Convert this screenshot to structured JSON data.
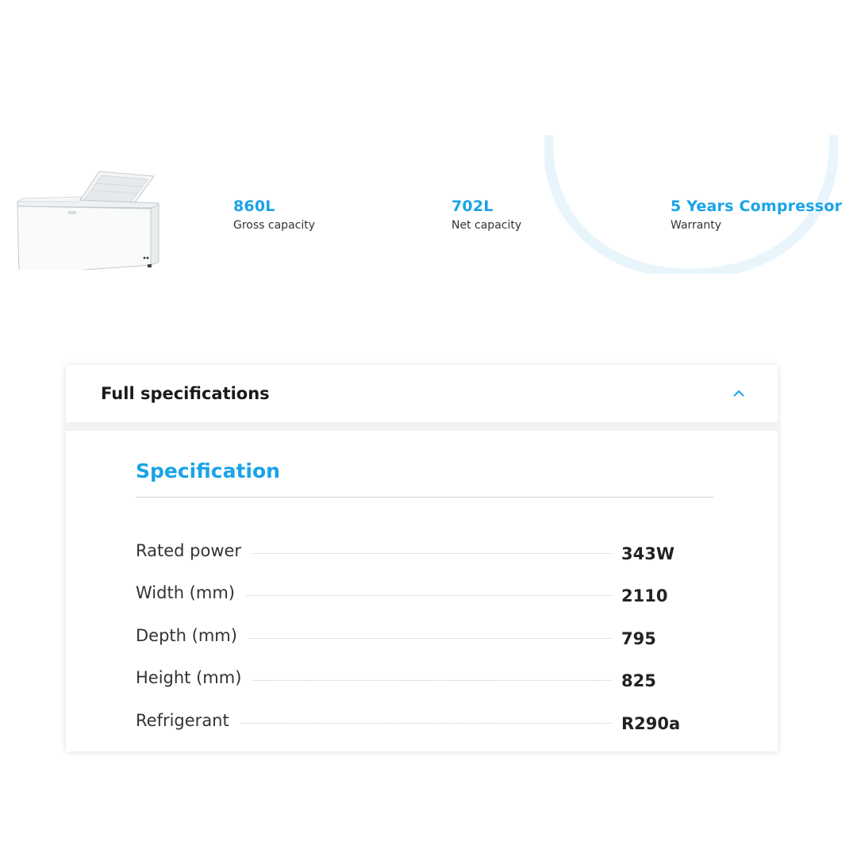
{
  "stats": [
    {
      "value": "860L",
      "label": "Gross capacity"
    },
    {
      "value": "702L",
      "label": "Net capacity"
    },
    {
      "value": "5 Years Compressor",
      "label": "Warranty"
    }
  ],
  "panel": {
    "title": "Full specifications",
    "section_title": "Specification",
    "specs": [
      {
        "label": "Rated power",
        "value": "343W"
      },
      {
        "label": "Width (mm)",
        "value": "2110"
      },
      {
        "label": "Depth (mm)",
        "value": "795"
      },
      {
        "label": "Height (mm)",
        "value": "825"
      },
      {
        "label": "Refrigerant",
        "value": "R290a"
      }
    ]
  },
  "colors": {
    "accent": "#1aa3e8",
    "text": "#222222",
    "deco": "#e8f6fc"
  },
  "icons": {
    "collapse": "chevron-up-icon",
    "product": "chest-freezer-image"
  }
}
